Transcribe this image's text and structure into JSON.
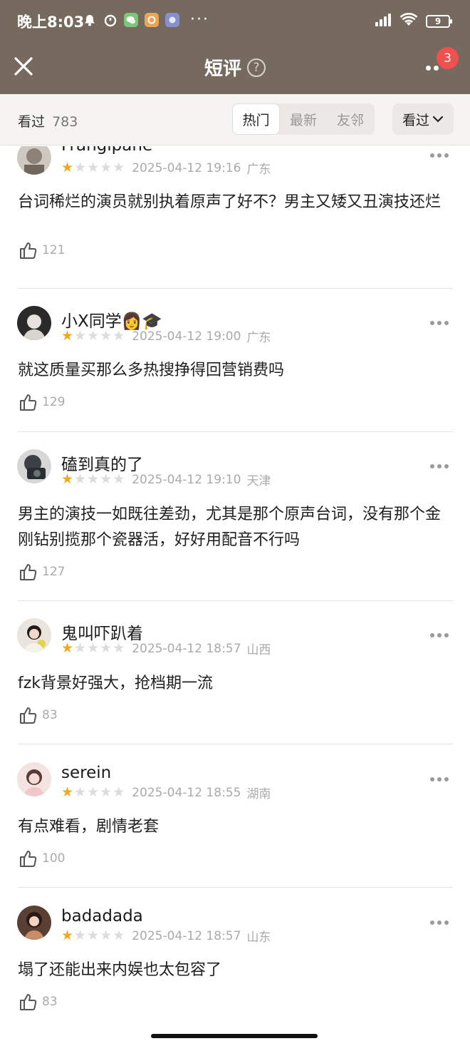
{
  "status": {
    "time": "晚上8:03",
    "battery": "9",
    "more_dots": "···"
  },
  "header": {
    "title": "短评",
    "help_glyph": "?",
    "notification_count": "3"
  },
  "filter": {
    "watched_label": "看过",
    "watched_count": "783",
    "tabs": [
      {
        "label": "热门",
        "active": true
      },
      {
        "label": "最新",
        "active": false
      },
      {
        "label": "友邻",
        "active": false
      }
    ],
    "status_filter": "看过"
  },
  "comments": [
    {
      "user": "Frangipane",
      "rating": 1,
      "date": "2025-04-12 19:16",
      "location": "广东",
      "text": "台词稀烂的演员就别执着原声了好不？男主又矮又丑演技还烂",
      "likes": "121",
      "avatar_color": "#8c8278"
    },
    {
      "user": "小X同学👩🎓",
      "rating": 1,
      "date": "2025-04-12 19:00",
      "location": "广东",
      "text": "就这质量买那么多热搜挣得回营销费吗",
      "likes": "129",
      "avatar_color": "#3a3a3a"
    },
    {
      "user": "磕到真的了",
      "rating": 1,
      "date": "2025-04-12 19:10",
      "location": "天津",
      "text": "男主的演技一如既往差劲，尤其是那个原声台词，没有那个金刚钻别揽那个瓷器活，好好用配音不行吗",
      "likes": "127",
      "avatar_color": "#4a4e55"
    },
    {
      "user": "鬼叫吓趴着",
      "rating": 1,
      "date": "2025-04-12 18:57",
      "location": "山西",
      "text": "fzk背景好强大，抢档期一流",
      "likes": "83",
      "avatar_color": "#d8c9b8"
    },
    {
      "user": "serein",
      "rating": 1,
      "date": "2025-04-12 18:55",
      "location": "湖南",
      "text": "有点难看，剧情老套",
      "likes": "100",
      "avatar_color": "#e8cfcf"
    },
    {
      "user": "badadada",
      "rating": 1,
      "date": "2025-04-12 18:57",
      "location": "山东",
      "text": "塌了还能出来内娱也太包容了",
      "likes": "83",
      "avatar_color": "#6b4a3a"
    }
  ],
  "colors": {
    "topbar": "#76695d",
    "star_on": "#f0a81c",
    "star_off": "#dcdcdc",
    "badge": "#f05050"
  }
}
